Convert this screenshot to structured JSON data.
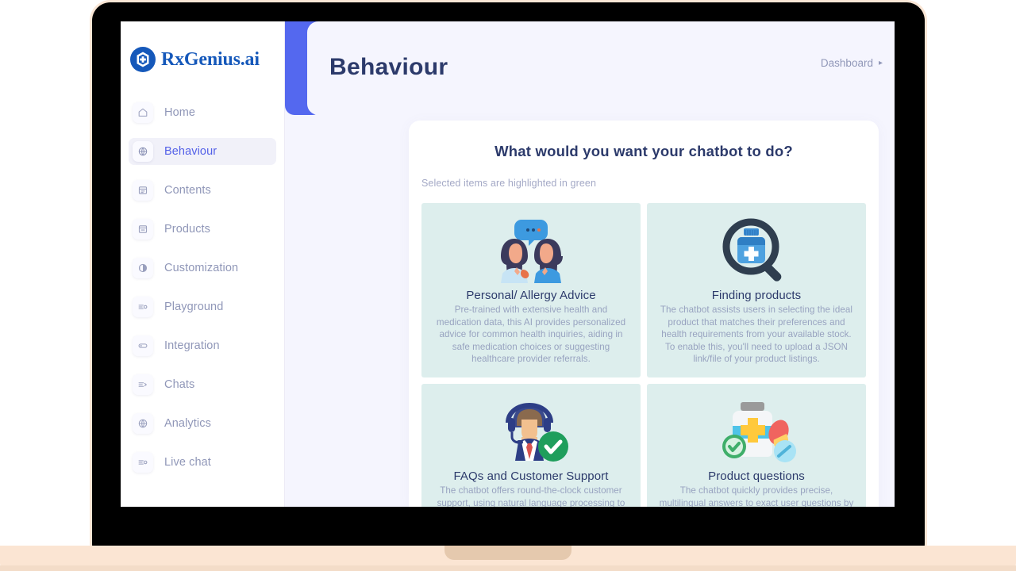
{
  "brand": {
    "name": "RxGenius.ai",
    "logo_icon": "rx-shield-plus-icon",
    "accent_color": "#1558ba"
  },
  "sidebar": {
    "items": [
      {
        "label": "Home",
        "icon": "home-icon",
        "active": false
      },
      {
        "label": "Behaviour",
        "icon": "behaviour-globe-icon",
        "active": true
      },
      {
        "label": "Contents",
        "icon": "contents-icon",
        "active": false
      },
      {
        "label": "Products",
        "icon": "products-icon",
        "active": false
      },
      {
        "label": "Customization",
        "icon": "customization-icon",
        "active": false
      },
      {
        "label": "Playground",
        "icon": "playground-icon",
        "active": false
      },
      {
        "label": "Integration",
        "icon": "integration-toggle-icon",
        "active": false
      },
      {
        "label": "Chats",
        "icon": "chats-icon",
        "active": false
      },
      {
        "label": "Analytics",
        "icon": "analytics-globe-icon",
        "active": false
      },
      {
        "label": "Live chat",
        "icon": "live-chat-icon",
        "active": false
      }
    ]
  },
  "header": {
    "title": "Behaviour",
    "breadcrumb": "Dashboard",
    "breadcrumb_caret": "▸",
    "accent_color": "#5468ef"
  },
  "panel": {
    "title": "What would you want your chatbot to do?",
    "subtitle": "Selected items are highlighted in green",
    "card_background": "#ddeeed",
    "selected_badge_color": "#25a05b",
    "options": [
      {
        "title": "Personal/ Allergy Advice",
        "description": "Pre-trained with extensive health and medication data, this AI provides personalized advice for common health inquiries, aiding in safe medication choices or suggesting healthcare provider referrals.",
        "art": "two-people-talking-icon",
        "selected": false
      },
      {
        "title": "Finding products",
        "description": "The chatbot assists users in selecting the ideal product that matches their preferences and health requirements from your available stock. To enable this, you'll need to upload a JSON link/file of your product listings.",
        "art": "magnifier-medicine-bottle-icon",
        "selected": false
      },
      {
        "title": "FAQs and Customer Support",
        "description": "The chatbot offers round-the-clock customer support, using natural language processing to answer questions from your",
        "art": "support-agent-headset-icon",
        "selected": true
      },
      {
        "title": "Product questions",
        "description": "The chatbot quickly provides precise, multilingual answers to exact user questions by analyzing product details",
        "art": "pill-bottle-pills-icon",
        "selected": true
      }
    ]
  }
}
